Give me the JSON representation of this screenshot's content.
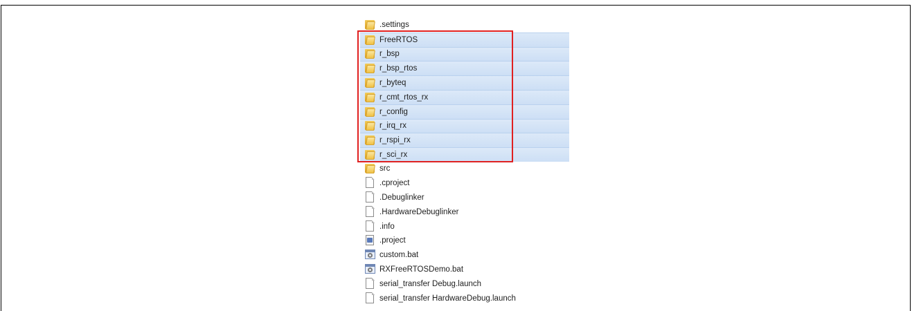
{
  "listing": {
    "items": [
      {
        "name": ".settings",
        "type": "folder",
        "selected": false
      },
      {
        "name": "FreeRTOS",
        "type": "folder",
        "selected": true
      },
      {
        "name": "r_bsp",
        "type": "folder",
        "selected": true
      },
      {
        "name": "r_bsp_rtos",
        "type": "folder",
        "selected": true
      },
      {
        "name": "r_byteq",
        "type": "folder",
        "selected": true
      },
      {
        "name": "r_cmt_rtos_rx",
        "type": "folder",
        "selected": true
      },
      {
        "name": "r_config",
        "type": "folder",
        "selected": true
      },
      {
        "name": "r_irq_rx",
        "type": "folder",
        "selected": true
      },
      {
        "name": "r_rspi_rx",
        "type": "folder",
        "selected": true
      },
      {
        "name": "r_sci_rx",
        "type": "folder",
        "selected": true
      },
      {
        "name": "src",
        "type": "folder",
        "selected": false
      },
      {
        "name": ".cproject",
        "type": "file",
        "selected": false
      },
      {
        "name": ".Debuglinker",
        "type": "file",
        "selected": false
      },
      {
        "name": ".HardwareDebuglinker",
        "type": "file",
        "selected": false
      },
      {
        "name": ".info",
        "type": "file",
        "selected": false
      },
      {
        "name": ".project",
        "type": "project",
        "selected": false
      },
      {
        "name": "custom.bat",
        "type": "bat",
        "selected": false
      },
      {
        "name": "RXFreeRTOSDemo.bat",
        "type": "bat",
        "selected": false
      },
      {
        "name": "serial_transfer Debug.launch",
        "type": "file",
        "selected": false
      },
      {
        "name": "serial_transfer HardwareDebug.launch",
        "type": "file",
        "selected": false
      }
    ]
  },
  "colors": {
    "selection": "#cddff5",
    "highlight_border": "#e02020",
    "text": "#1e1e1e"
  },
  "icons": {
    "folder": "folder-icon",
    "file": "file-icon",
    "project": "project-file-icon",
    "bat": "batch-file-icon"
  }
}
